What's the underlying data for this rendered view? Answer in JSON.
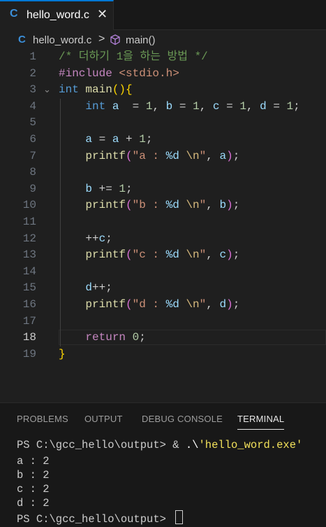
{
  "tab": {
    "icon_text": "C",
    "label": "hello_word.c",
    "close": "✕",
    "active_color": "#0078d4"
  },
  "breadcrumb": {
    "file_icon_text": "C",
    "file": "hello_word.c",
    "separator": ">",
    "symbol_icon": "cube-icon",
    "symbol": "main()"
  },
  "editor": {
    "active_line": 18,
    "lines": [
      {
        "n": "1"
      },
      {
        "n": "2"
      },
      {
        "n": "3"
      },
      {
        "n": "4"
      },
      {
        "n": "5"
      },
      {
        "n": "6"
      },
      {
        "n": "7"
      },
      {
        "n": "8"
      },
      {
        "n": "9"
      },
      {
        "n": "10"
      },
      {
        "n": "11"
      },
      {
        "n": "12"
      },
      {
        "n": "13"
      },
      {
        "n": "14"
      },
      {
        "n": "15"
      },
      {
        "n": "16"
      },
      {
        "n": "17"
      },
      {
        "n": "18"
      },
      {
        "n": "19"
      }
    ],
    "code": {
      "l1": "/* 더하기 1을 하는 방법 */",
      "l2_directive": "#include",
      "l2_header": "<stdio.h>",
      "l3_type": "int",
      "l3_name": "main",
      "l4_type": "int",
      "l4_a": "a",
      "l4_eq1": "  = ",
      "l4_v1": "1",
      "l4_b": "b",
      "l4_v2": "1",
      "l4_c": "c",
      "l4_v3": "1",
      "l4_d": "d",
      "l4_v4": "1",
      "l6_a1": "a",
      "l6_a2": "a",
      "l6_v": "1",
      "l7_fn": "printf",
      "l7_str1": "\"a : ",
      "l7_fmt": "%d",
      "l7_esc": "\\n",
      "l7_str2": "\"",
      "l7_arg": "a",
      "l9_b": "b",
      "l9_v": "1",
      "l10_fn": "printf",
      "l10_str1": "\"b : ",
      "l10_fmt": "%d",
      "l10_esc": "\\n",
      "l10_str2": "\"",
      "l10_arg": "b",
      "l12_op": "++",
      "l12_c": "c",
      "l13_fn": "printf",
      "l13_str1": "\"c : ",
      "l13_fmt": "%d",
      "l13_esc": "\\n",
      "l13_str2": "\"",
      "l13_arg": "c",
      "l15_d": "d",
      "l15_op": "++",
      "l16_fn": "printf",
      "l16_str1": "\"d : ",
      "l16_fmt": "%d",
      "l16_esc": "\\n",
      "l16_str2": "\"",
      "l16_arg": "d",
      "l18_kw": "return",
      "l18_v": "0"
    }
  },
  "panel": {
    "tabs": [
      "PROBLEMS",
      "OUTPUT",
      "DEBUG CONSOLE",
      "TERMINAL"
    ],
    "active_tab": "TERMINAL",
    "terminal": {
      "prompt1": "PS C:\\gcc_hello\\output> ",
      "cmd_amp": "&",
      "cmd_dot": ".\\",
      "cmd_str": "'hello_word.exe'",
      "out": [
        "a : 2",
        "b : 2",
        "c : 2",
        "d : 2"
      ],
      "prompt2": "PS C:\\gcc_hello\\output> "
    }
  }
}
